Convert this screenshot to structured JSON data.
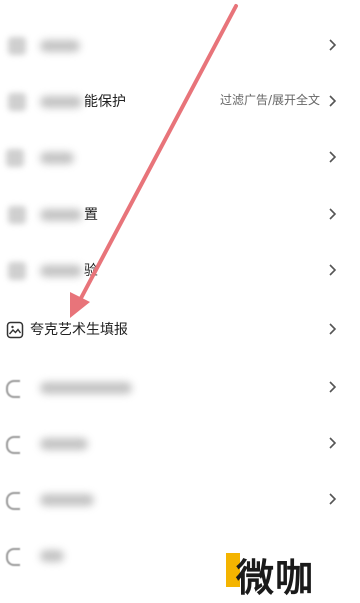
{
  "settings_list": {
    "rows": [
      {
        "id": "row1",
        "label": "",
        "hint": "",
        "blurred": true
      },
      {
        "id": "row2",
        "label_suffix": "能保护",
        "hint": "过滤广告/展开全文",
        "blurred": true
      },
      {
        "id": "row3",
        "label": "",
        "hint": "",
        "blurred": true
      },
      {
        "id": "row4",
        "label_suffix": "置",
        "hint": "",
        "blurred": true
      },
      {
        "id": "row5",
        "label_suffix": "验",
        "hint": "",
        "blurred": true
      },
      {
        "id": "row6",
        "label": "夸克艺术生填报",
        "hint": "",
        "blurred": false
      },
      {
        "id": "row7",
        "label": "",
        "hint": "",
        "blurred": true
      },
      {
        "id": "row8",
        "label": "",
        "hint": "",
        "blurred": true
      },
      {
        "id": "row9",
        "label": "",
        "hint": "",
        "blurred": true
      },
      {
        "id": "row10",
        "label": "",
        "hint": "",
        "blurred": true
      }
    ]
  },
  "annotation": {
    "arrow_color": "#e8747a"
  },
  "watermark": {
    "text": "微咖",
    "accent_color": "#f4b400"
  },
  "icons": {
    "chevron": "chevron-right-icon",
    "art_form": "image-frame-icon"
  }
}
